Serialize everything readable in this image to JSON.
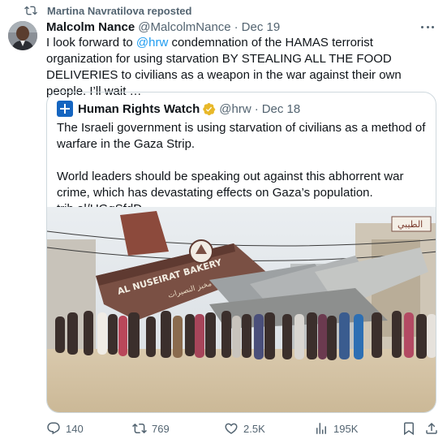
{
  "repost": {
    "text": "Martina Navratilova reposted",
    "icon": "repost-icon"
  },
  "author": {
    "name": "Malcolm Nance",
    "handle": "@MalcolmNance",
    "separator": "·",
    "date": "Dec 19"
  },
  "tweet": {
    "before_mention": "I look forward to ",
    "mention": "@hrw",
    "after_mention": " condemnation of the HAMAS terrorist organization for using starvation BY STEALING ALL THE FOOD DELIVERIES to civilians as a weapon in the war against their own people.  I’ll wait …"
  },
  "quote": {
    "name": "Human Rights Watch",
    "verified": "gold-check",
    "handle": "@hrw",
    "separator": "·",
    "date": "Dec 18",
    "paragraph1": "The Israeli government is using starvation of civilians as a method of warfare in the Gaza Strip.",
    "paragraph2": "World leaders should be speaking out against this abhorrent war crime, which has devastating effects on Gaza’s population. trib.al/UGqSfdD",
    "image": {
      "description_icon": "photo",
      "sign_text": "AL NUSEIRAT BAKERY",
      "arabic_sign": "مخبز النصيرات",
      "right_sign": "الطيبي"
    }
  },
  "actions": {
    "replies": "140",
    "reposts": "769",
    "likes": "2.5K",
    "views": "195K"
  },
  "colors": {
    "text": "#0f1419",
    "secondary": "#536471",
    "link": "#1d9bf0",
    "border": "#cfd9de",
    "verified_gold": "#e8b829",
    "hrw_blue": "#1565c0"
  }
}
